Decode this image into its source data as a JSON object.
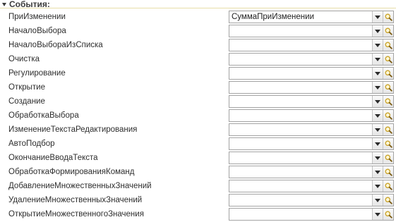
{
  "section": {
    "title": "События:"
  },
  "icons": {
    "collapse": "triangle-down-icon",
    "dropdown": "chevron-down-icon",
    "search": "magnifier-icon"
  },
  "colors": {
    "header_rule": "#e8dfa8",
    "field_border": "#a3a3a3",
    "search_icon": "#c9a227"
  },
  "events": [
    {
      "label": "ПриИзменении",
      "value": "СуммаПриИзменении"
    },
    {
      "label": "НачалоВыбора",
      "value": ""
    },
    {
      "label": "НачалоВыбораИзСписка",
      "value": ""
    },
    {
      "label": "Очистка",
      "value": ""
    },
    {
      "label": "Регулирование",
      "value": ""
    },
    {
      "label": "Открытие",
      "value": ""
    },
    {
      "label": "Создание",
      "value": ""
    },
    {
      "label": "ОбработкаВыбора",
      "value": ""
    },
    {
      "label": "ИзменениеТекстаРедактирования",
      "value": ""
    },
    {
      "label": "АвтоПодбор",
      "value": ""
    },
    {
      "label": "ОкончаниеВводаТекста",
      "value": ""
    },
    {
      "label": "ОбработкаФормированияКоманд",
      "value": ""
    },
    {
      "label": "ДобавлениеМножественныхЗначений",
      "value": ""
    },
    {
      "label": "УдалениеМножественныхЗначений",
      "value": ""
    },
    {
      "label": "ОткрытиеМножественногоЗначения",
      "value": ""
    }
  ]
}
